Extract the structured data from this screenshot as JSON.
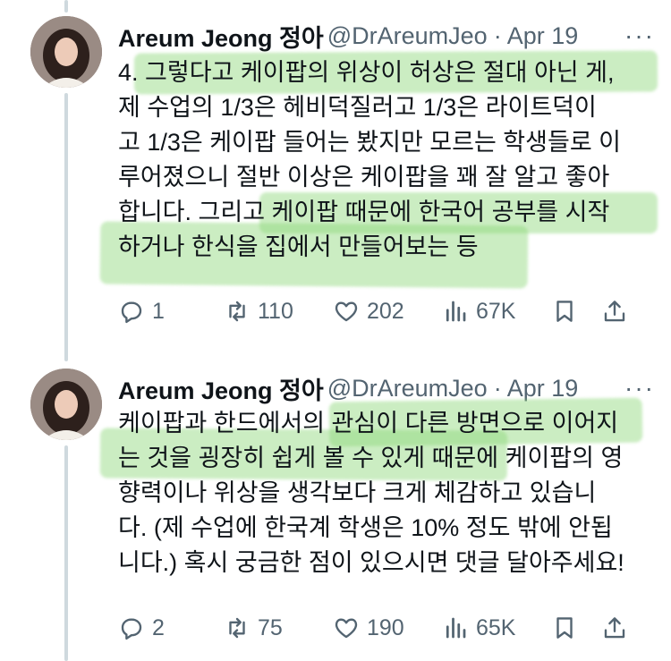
{
  "tweets": [
    {
      "author_name": "Areum Jeong 정아",
      "handle": "@DrAreumJeong",
      "separator": "·",
      "date": "Apr 19",
      "more": "···",
      "lines": [
        "4. 그렇다고 케이팝의 위상이 허상은 절대 아닌 게,",
        "제 수업의 1/3은 헤비덕질러고 1/3은 라이트덕이",
        "고 1/3은 케이팝 들어는 봤지만 모르는 학생들로 이",
        "루어졌으니 절반 이상은 케이팝을 꽤 잘 알고 좋아",
        "합니다. 그리고 케이팝 때문에 한국어 공부를 시작",
        "하거나 한식을 집에서 만들어보는 등"
      ],
      "replies": "1",
      "retweets": "110",
      "likes": "202",
      "views": "67K"
    },
    {
      "author_name": "Areum Jeong 정아",
      "handle": "@DrAreumJeong",
      "separator": "·",
      "date": "Apr 19",
      "more": "···",
      "lines": [
        "케이팝과 한드에서의 관심이 다른 방면으로 이어지",
        "는 것을 굉장히 쉽게 볼 수 있게 때문에 케이팝의 영",
        "향력이나 위상을 생각보다 크게 체감하고 있습니",
        "다. (제 수업에 한국계 학생은 10% 정도 밖에 안됩",
        "니다.) 혹시 궁금한 점이 있으시면 댓글 달아주세요!"
      ],
      "replies": "2",
      "retweets": "75",
      "likes": "190",
      "views": "65K"
    }
  ],
  "icons": [
    "reply-icon",
    "retweet-icon",
    "like-icon",
    "views-icon",
    "bookmark-icon",
    "share-icon"
  ],
  "colors": {
    "text": "#0f1419",
    "secondary": "#536471",
    "highlight": "#8cd678",
    "thread_line": "#cfd9de"
  }
}
